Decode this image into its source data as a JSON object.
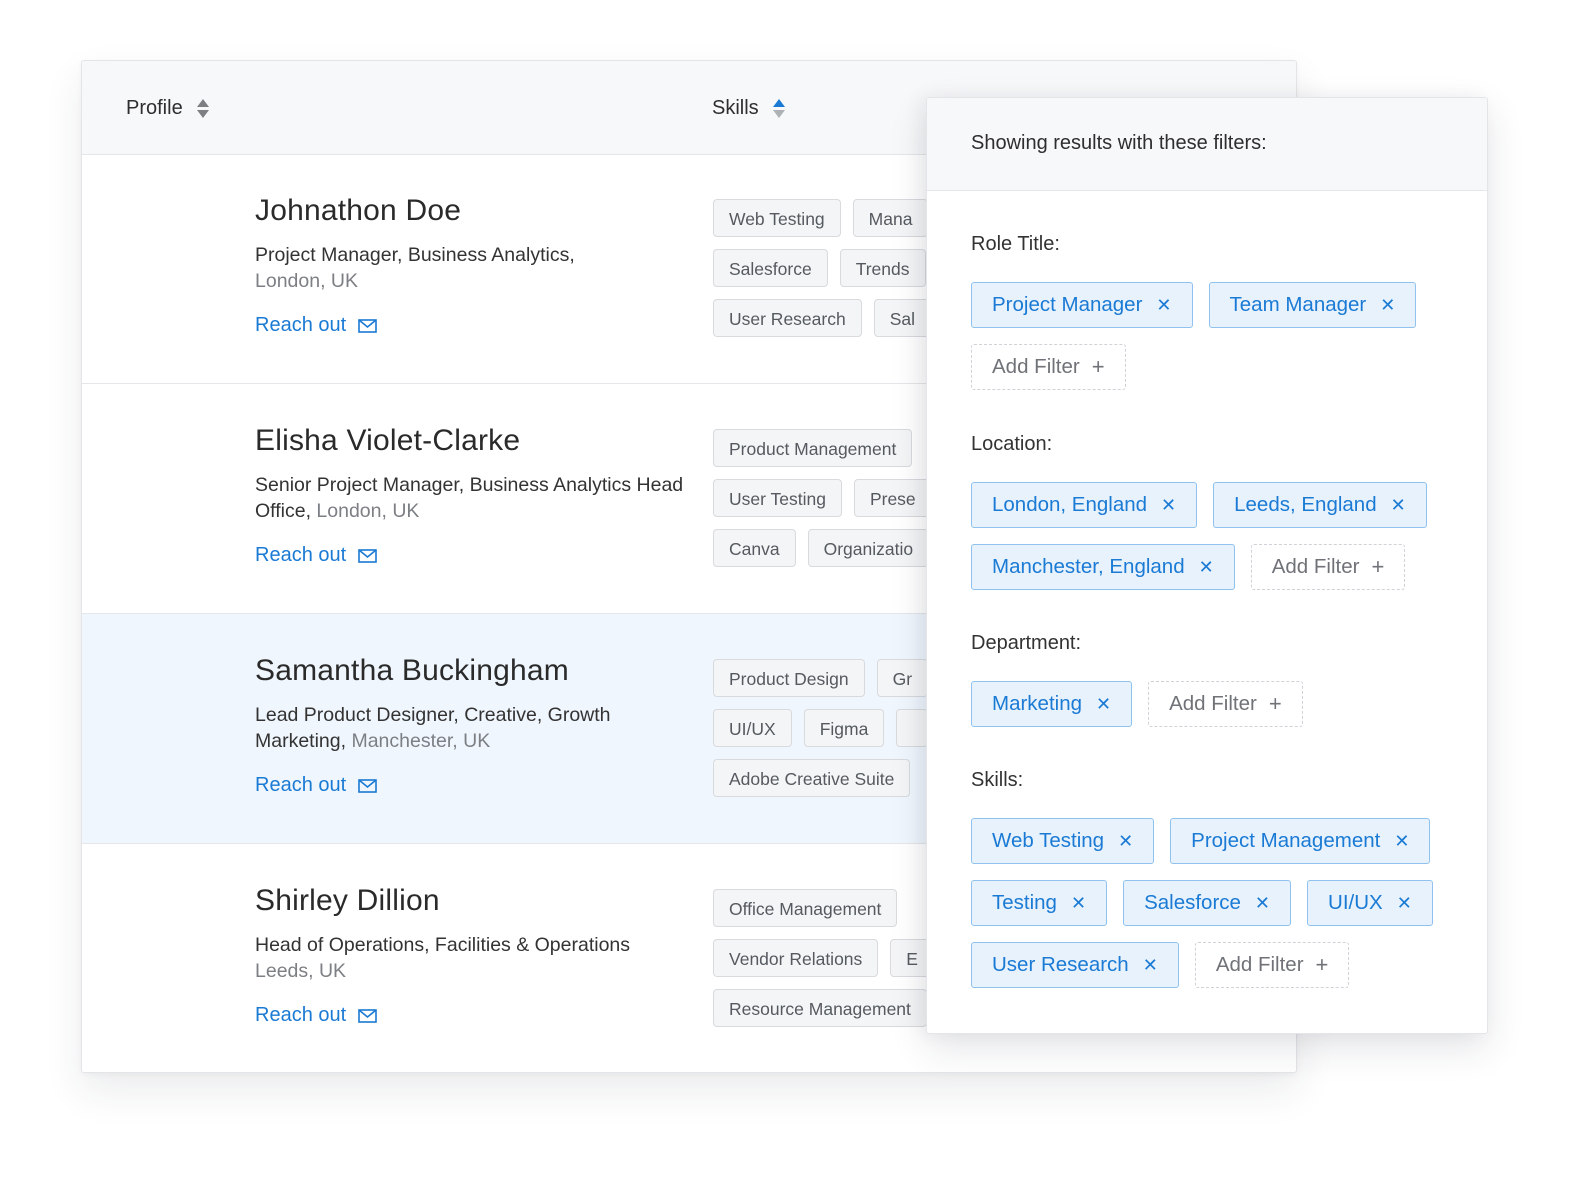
{
  "table": {
    "headers": {
      "profile": "Profile",
      "skills": "Skills"
    },
    "reach_label": "Reach out",
    "people": [
      {
        "name": "Johnathon Doe",
        "role": "Project Manager, Business Analytics,",
        "location": "London, UK",
        "skills": [
          [
            "Web Testing",
            "Mana"
          ],
          [
            "Salesforce",
            "Trends"
          ],
          [
            "User Research",
            "Sal"
          ]
        ]
      },
      {
        "name": "Elisha Violet-Clarke",
        "role": "Senior Project Manager, Business Analytics Head Office,",
        "location": "London, UK",
        "skills": [
          [
            "Product Management"
          ],
          [
            "User Testing",
            "Prese"
          ],
          [
            "Canva",
            "Organizatio"
          ]
        ]
      },
      {
        "name": "Samantha Buckingham",
        "role": "Lead Product Designer, Creative, Growth Marketing,",
        "location": "Manchester, UK",
        "skills": [
          [
            "Product Design",
            "Gr"
          ],
          [
            "UI/UX",
            "Figma",
            ""
          ],
          [
            "Adobe Creative Suite"
          ]
        ]
      },
      {
        "name": "Shirley Dillion",
        "role": "Head of Operations, Facilities & Operations",
        "location": "Leeds, UK",
        "skills": [
          [
            "Office Management"
          ],
          [
            "Vendor Relations",
            "E"
          ],
          [
            "Resource Management"
          ]
        ]
      }
    ]
  },
  "filters": {
    "header": "Showing results with these filters:",
    "add_filter_label": "Add Filter",
    "sections": [
      {
        "title": "Role Title:",
        "tags": [
          "Project Manager",
          "Team Manager"
        ]
      },
      {
        "title": "Location:",
        "tags": [
          "London, England",
          "Leeds, England",
          "Manchester, England"
        ]
      },
      {
        "title": "Department:",
        "tags": [
          "Marketing"
        ]
      },
      {
        "title": "Skills:",
        "tags": [
          "Web Testing",
          "Project Management",
          "Testing",
          "Salesforce",
          "UI/UX",
          "User Research"
        ]
      }
    ]
  },
  "colors": {
    "accent": "#1a7ad4",
    "tag_bg": "#e7f2fd",
    "highlight_row": "#f0f6fd"
  }
}
